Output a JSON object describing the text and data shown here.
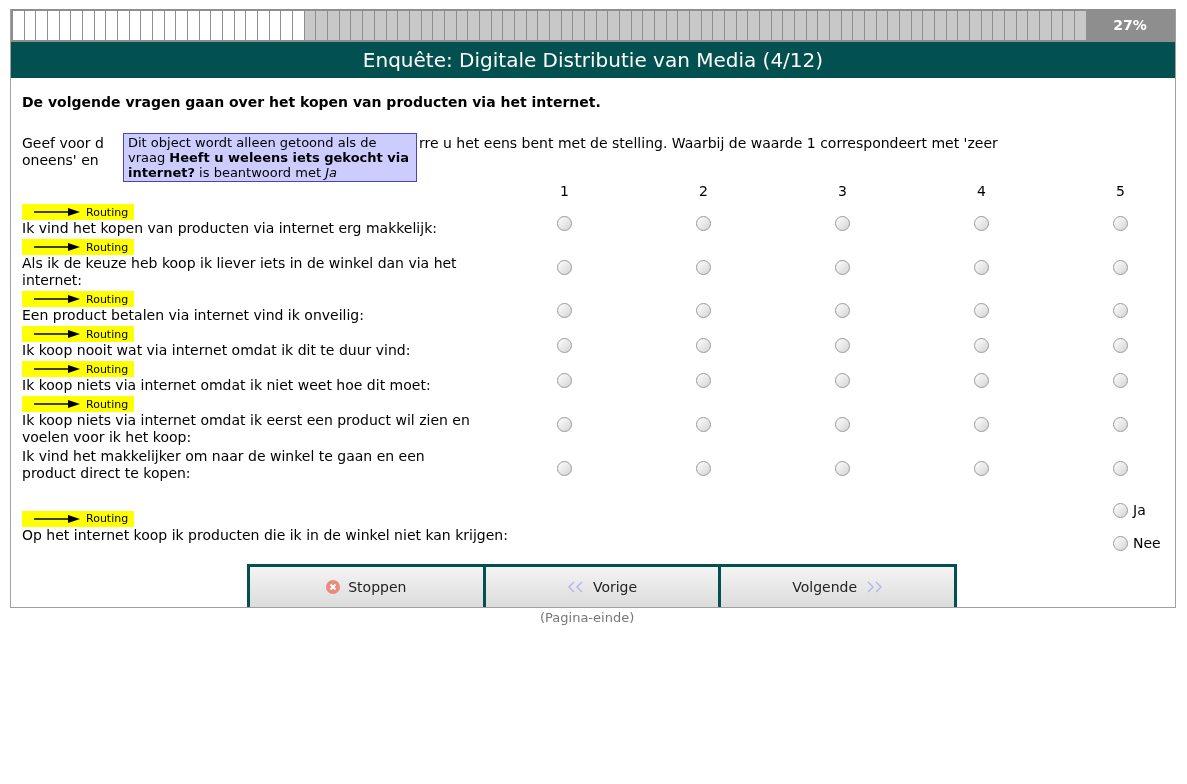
{
  "progress": {
    "level": 0.27,
    "label": "27%"
  },
  "header": {
    "title": "Enquête: Digitale Distributie van Media (4/12)"
  },
  "intro": "De volgende vragen gaan over het kopen van producten via het internet.",
  "instruction": {
    "before_tooltip": "Geef voor d",
    "after_tooltip": "rre u het eens bent met de stelling. Waarbij de waarde 1 correspondeert met 'zeer",
    "second_line": "oneens' en"
  },
  "tooltip": {
    "text": "Dit object wordt alleen getoond als de vraag **Heeft u weleens iets gekocht via internet?** is beantwoord met *Ja*"
  },
  "scale": [
    "1",
    "2",
    "3",
    "4",
    "5"
  ],
  "questions": [
    {
      "kind": "scale",
      "routing": "Routing",
      "text": "Ik vind het kopen van producten via internet erg makkelijk:",
      "options": [
        {
          "selected": false
        },
        {
          "selected": false
        },
        {
          "selected": false
        },
        {
          "selected": false
        },
        {
          "selected": false
        }
      ]
    },
    {
      "kind": "scale",
      "routing": "Routing",
      "text": "Als ik de keuze heb koop ik liever iets in de winkel dan via het internet:",
      "options": [
        {
          "selected": false
        },
        {
          "selected": false
        },
        {
          "selected": false
        },
        {
          "selected": false
        },
        {
          "selected": false
        }
      ]
    },
    {
      "kind": "scale",
      "routing": "Routing",
      "text": "Een product betalen via internet vind ik onveilig:",
      "options": [
        {
          "selected": false
        },
        {
          "selected": false
        },
        {
          "selected": false
        },
        {
          "selected": false
        },
        {
          "selected": false
        }
      ]
    },
    {
      "kind": "scale",
      "routing": "Routing",
      "text": "Ik koop nooit wat via internet omdat ik dit te duur vind:",
      "options": [
        {
          "selected": false
        },
        {
          "selected": false
        },
        {
          "selected": false
        },
        {
          "selected": false
        },
        {
          "selected": false
        }
      ]
    },
    {
      "kind": "scale",
      "routing": "Routing",
      "text": "Ik koop niets via internet omdat ik niet weet hoe dit moet:",
      "options": [
        {
          "selected": false
        },
        {
          "selected": false
        },
        {
          "selected": false
        },
        {
          "selected": false
        },
        {
          "selected": false
        }
      ]
    },
    {
      "kind": "scale",
      "routing": "Routing",
      "text": "Ik koop niets via internet omdat ik eerst een product wil zien en voelen voor ik het koop:",
      "options": [
        {
          "selected": false
        },
        {
          "selected": false
        },
        {
          "selected": false
        },
        {
          "selected": false
        },
        {
          "selected": false
        }
      ]
    },
    {
      "kind": "scale",
      "text": "Ik vind het makkelijker om naar de winkel te gaan en een product direct te kopen:",
      "options": [
        {
          "selected": false
        },
        {
          "selected": false
        },
        {
          "selected": false
        },
        {
          "selected": false
        },
        {
          "selected": false
        }
      ]
    },
    {
      "kind": "choice",
      "routing": "Routing",
      "text": "Op het internet koop ik producten die ik in de winkel niet kan krijgen:",
      "options": [
        {
          "label": "Ja",
          "selected": false
        },
        {
          "label": "Nee",
          "selected": false
        }
      ]
    }
  ],
  "buttons": [
    {
      "kind": "stop",
      "label": "Stoppen"
    },
    {
      "kind": "previous",
      "label": "Vorige"
    },
    {
      "kind": "next",
      "label": "Volgende"
    }
  ],
  "footer": "(Pagina-einde)"
}
